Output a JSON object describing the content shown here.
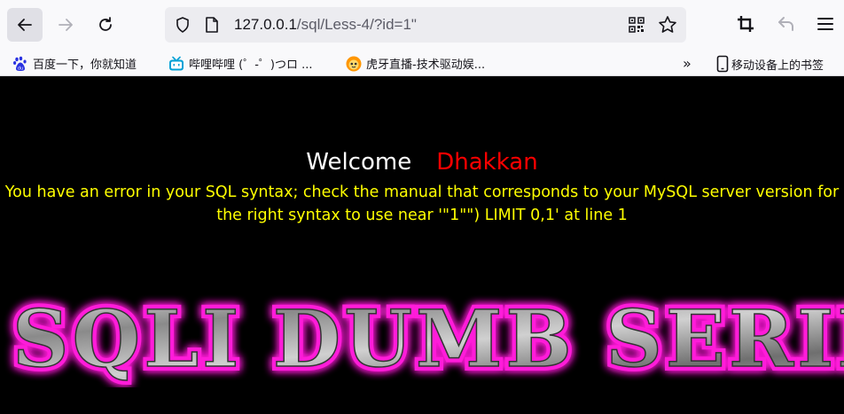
{
  "browser": {
    "url_host": "127.0.0.1",
    "url_path": "/sql/Less-4/?id=1\"",
    "icons": [
      "back-icon",
      "forward-icon",
      "reload-icon",
      "shield-icon",
      "page-icon",
      "qr-code-icon",
      "bookmark-star-icon",
      "crop-icon",
      "undo-icon",
      "menu-icon"
    ]
  },
  "bookmarks": {
    "items": [
      {
        "label": "百度一下，你就知道",
        "icon": "baidu-icon"
      },
      {
        "label": "哔哩哔哩 (゜-゜)つロ ...",
        "icon": "bilibili-icon"
      },
      {
        "label": "虎牙直播-技术驱动娱...",
        "icon": "huya-icon"
      }
    ],
    "more": "»",
    "mobile_label": "移动设备上的书签"
  },
  "page": {
    "welcome": "Welcome",
    "name": "Dhakkan",
    "error": "You have an error in your SQL syntax; check the manual that corresponds to your MySQL server version for the right syntax to use near '\"1\"\") LIMIT 0,1' at line 1",
    "banner_text": "SQLI DUMB SERIES",
    "colors": {
      "welcome": "#ffffff",
      "name": "#ff0000",
      "error": "#ffff00",
      "banner_glow": "#ff1ad9"
    }
  }
}
